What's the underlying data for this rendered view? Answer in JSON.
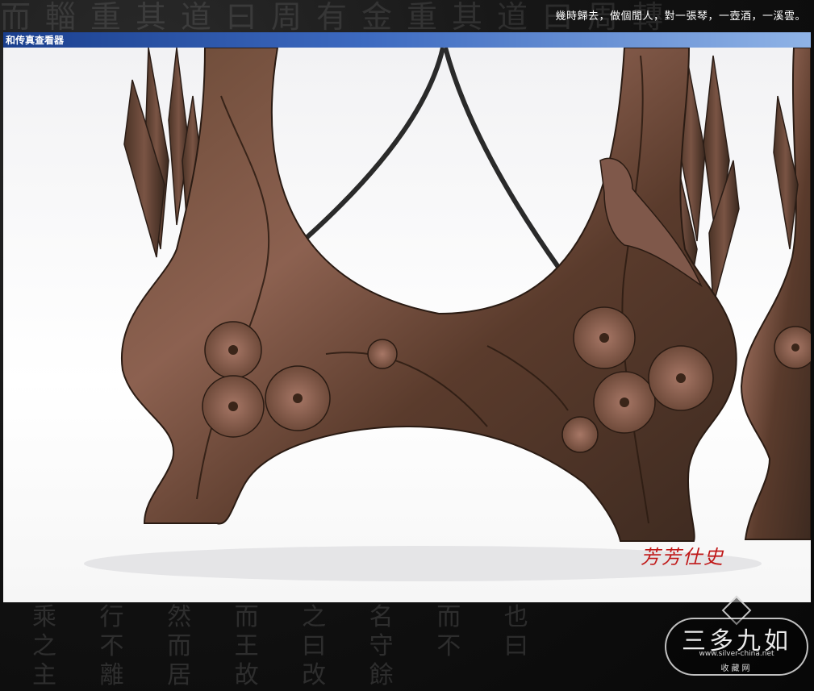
{
  "header": {
    "tagline": "幾時歸去，做個閒人，對一張琴，一壺酒，一溪雲。",
    "background_text": "而輜重其道曰周有金重其道曰周轉"
  },
  "viewer": {
    "title": "和传真查看器"
  },
  "photo": {
    "seal_text": "芳芳仕史"
  },
  "footer": {
    "background_text_line1": "乘 行 然 而 之 名 而 也",
    "background_text_line2": "之 不 而 王 曰 守 不 曰",
    "background_text_line3": "主 離 居 故 改 餘"
  },
  "logo": {
    "title": "三多九如",
    "url": "www.silver-china.net",
    "sub": "收藏网"
  },
  "colors": {
    "titlebar_start": "#1a3f8e",
    "titlebar_end": "#8fb3e6",
    "seal_red": "#c01818",
    "page_bg": "#0d0d0d"
  }
}
